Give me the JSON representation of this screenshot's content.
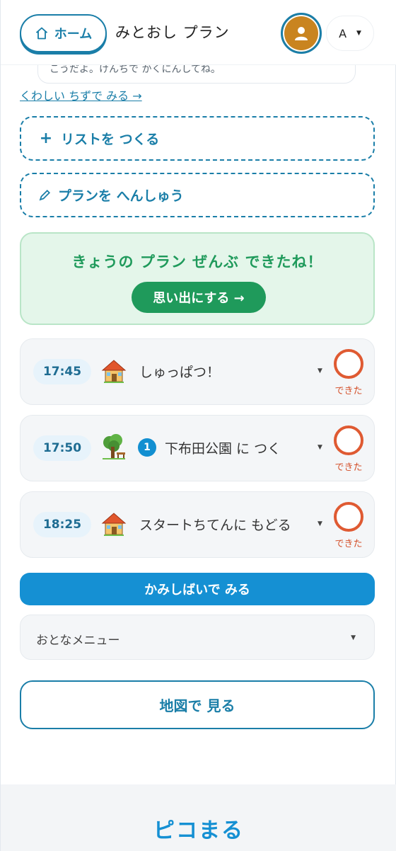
{
  "header": {
    "home_label": "ホーム",
    "title": "みとおし プラン",
    "lang_label": "A"
  },
  "notice": {
    "text": "こうだよ。けんちで かくにんしてね。",
    "detail_link": "くわしい ちずで みる →"
  },
  "actions": {
    "create_list": "リストを つくる",
    "edit_plan": "プランを へんしゅう"
  },
  "done_card": {
    "message": "きょうの プラン ぜんぶ できたね！",
    "button": "思い出にする →"
  },
  "plan_items": [
    {
      "time": "17:45",
      "icon": "house-icon",
      "number": "",
      "label": "しゅっぱつ！",
      "done_label": "できた"
    },
    {
      "time": "17:50",
      "icon": "tree-bench-icon",
      "number": "1",
      "label": "下布田公園 に つく",
      "done_label": "できた"
    },
    {
      "time": "18:25",
      "icon": "house-icon",
      "number": "",
      "label": "スタートちてんに もどる",
      "done_label": "できた"
    }
  ],
  "kamishibai_button": "かみしばいで みる",
  "adult_menu": {
    "selected": "おとなメニュー"
  },
  "map_button": "地図で 見る",
  "footer": {
    "logo": "ピコまる"
  },
  "colors": {
    "primary": "#1a7ea8",
    "accent_blue": "#1590d3",
    "success": "#1f9a5b",
    "success_bg": "#e4f6ea",
    "check": "#df5a32",
    "avatar": "#c9841f"
  }
}
